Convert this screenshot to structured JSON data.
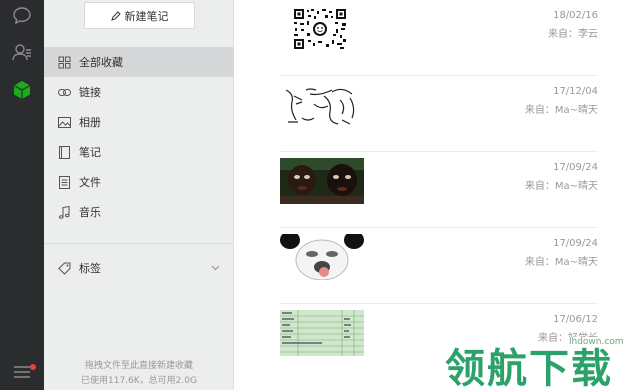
{
  "rail": {
    "icons": [
      "chat-icon",
      "contacts-icon",
      "favorites-cube-icon",
      "menu-icon"
    ]
  },
  "sidebar": {
    "new_note_label": "新建笔记",
    "items": [
      {
        "label": "全部收藏",
        "icon": "grid-icon",
        "active": true
      },
      {
        "label": "链接",
        "icon": "link-icon"
      },
      {
        "label": "相册",
        "icon": "image-icon"
      },
      {
        "label": "笔记",
        "icon": "note-icon"
      },
      {
        "label": "文件",
        "icon": "file-icon"
      },
      {
        "label": "音乐",
        "icon": "music-icon"
      }
    ],
    "tags_label": "标签",
    "storage_line1": "拖拽文件至此直接新建收藏",
    "storage_line2": "已使用117.6K，总可用2.0G"
  },
  "items": [
    {
      "date": "18/02/16",
      "from": "来自：李云",
      "thumb": "qr-code"
    },
    {
      "date": "17/12/04",
      "from": "来自：Ma~晴天",
      "thumb": "sketch"
    },
    {
      "date": "17/09/24",
      "from": "来自：Ma~晴天",
      "thumb": "photo-faces"
    },
    {
      "date": "17/09/24",
      "from": "来自：Ma~晴天",
      "thumb": "panda-meme"
    },
    {
      "date": "17/06/12",
      "from": "来自：好学长",
      "thumb": "spreadsheet"
    }
  ],
  "watermark": {
    "text": "领航下载",
    "url": "lhdown.com"
  },
  "colors": {
    "rail": "#2b2c2e",
    "sidebar": "#eceded",
    "accent": "#1aad19",
    "watermark": "#2ba26a"
  }
}
